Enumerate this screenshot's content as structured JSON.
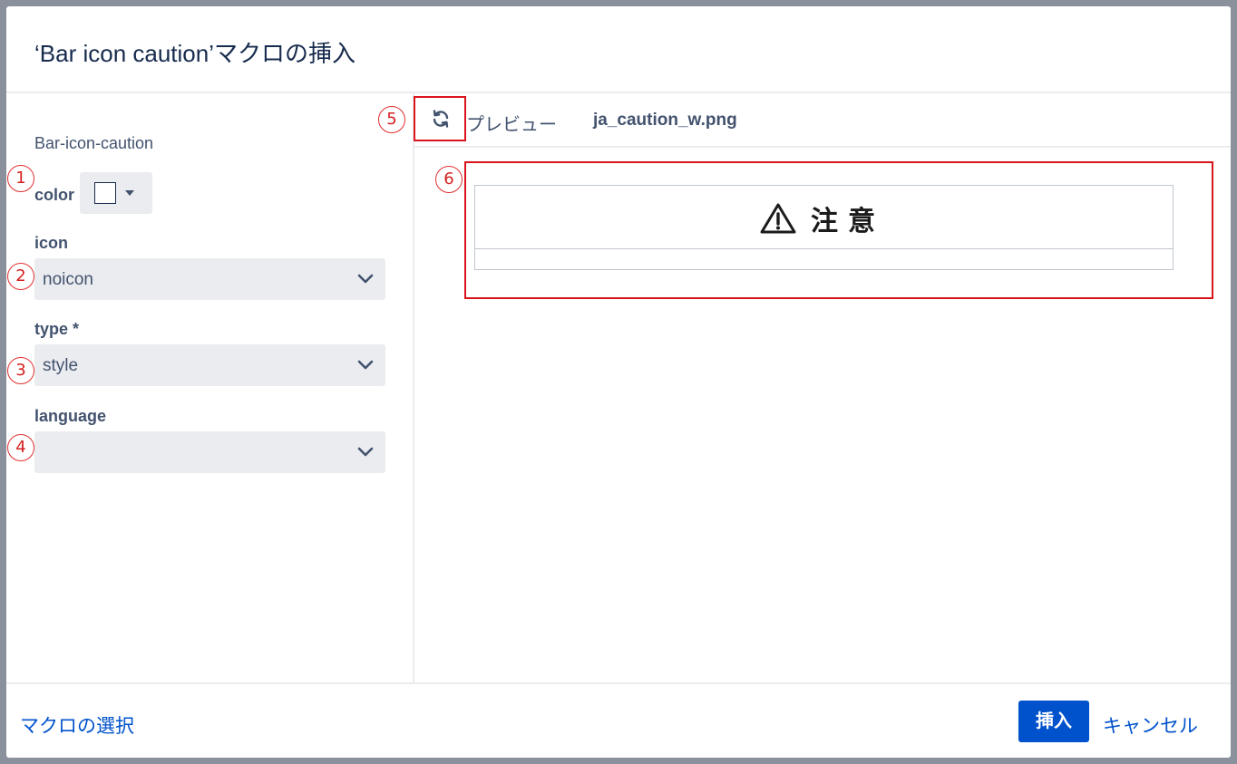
{
  "dialog": {
    "title": "‘Bar icon caution’マクロの挿入"
  },
  "form": {
    "macro_name": "Bar-icon-caution",
    "color": {
      "label": "color",
      "value": "#ffffff",
      "icon": "caret-down-icon"
    },
    "icon_field": {
      "label": "icon",
      "value": "noicon"
    },
    "type_field": {
      "label": "type *",
      "value": "style"
    },
    "language_field": {
      "label": "language",
      "value": ""
    }
  },
  "preview": {
    "refresh_icon": "refresh-icon",
    "label": "プレビュー",
    "filename": "ja_caution_w.png",
    "caution_text": "注意",
    "caution_icon": "warning-triangle-icon"
  },
  "callouts": [
    "1",
    "2",
    "3",
    "4",
    "5",
    "6"
  ],
  "footer": {
    "select_macro_link": "マクロの選択",
    "insert_button": "挿入",
    "cancel_link": "キャンセル"
  },
  "colors": {
    "primary": "#0052cc",
    "annotation_red": "#d9141b",
    "text": "#172b4d"
  }
}
